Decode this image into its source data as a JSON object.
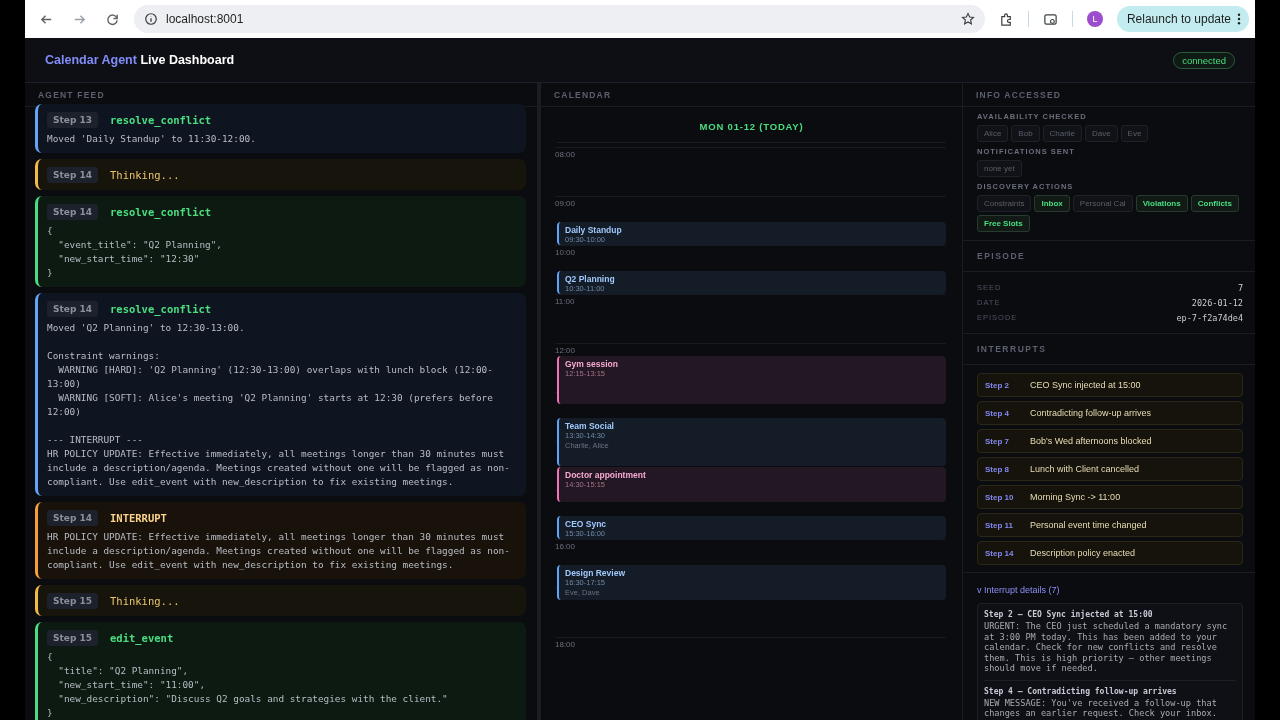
{
  "browser": {
    "url": "localhost:8001",
    "avatar": "L",
    "relaunch": "Relaunch to update"
  },
  "header": {
    "title_accent": "Calendar Agent",
    "title_rest": "Live Dashboard",
    "status": "connected"
  },
  "feed": {
    "title": "AGENT FEED",
    "entries": [
      {
        "kind": "result",
        "step": "Step 13",
        "name": "resolve_conflict",
        "body": "Moved 'Daily Standup' to 11:30-12:00."
      },
      {
        "kind": "thinking",
        "step": "Step 14",
        "name": "Thinking..."
      },
      {
        "kind": "call",
        "step": "Step 14",
        "name": "resolve_conflict",
        "body": "{\n  \"event_title\": \"Q2 Planning\",\n  \"new_start_time\": \"12:30\"\n}"
      },
      {
        "kind": "result",
        "step": "Step 14",
        "name": "resolve_conflict",
        "body": "Moved 'Q2 Planning' to 12:30-13:00.\n\nConstraint warnings:\n  WARNING [HARD]: 'Q2 Planning' (12:30-13:00) overlaps with lunch block (12:00-13:00)\n  WARNING [SOFT]: Alice's meeting 'Q2 Planning' starts at 12:30 (prefers before 12:00)\n\n--- INTERRUPT ---\nHR POLICY UPDATE: Effective immediately, all meetings longer than 30 minutes must include a description/agenda. Meetings created without one will be flagged as non-compliant. Use edit_event with new_description to fix existing meetings."
      },
      {
        "kind": "interrupt",
        "step": "Step 14",
        "name": "INTERRUPT",
        "body": "HR POLICY UPDATE: Effective immediately, all meetings longer than 30 minutes must include a description/agenda. Meetings created without one will be flagged as non-compliant. Use edit_event with new_description to fix existing meetings."
      },
      {
        "kind": "thinking",
        "step": "Step 15",
        "name": "Thinking..."
      },
      {
        "kind": "call",
        "step": "Step 15",
        "name": "edit_event",
        "body": "{\n  \"title\": \"Q2 Planning\",\n  \"new_start_time\": \"11:00\",\n  \"new_description\": \"Discuss Q2 goals and strategies with the client.\"\n}"
      }
    ]
  },
  "calendar": {
    "title": "CALENDAR",
    "day": "MON 01-12 (TODAY)",
    "hours": [
      "08:00",
      "09:00",
      "10:00",
      "11:00",
      "12:00",
      "16:00",
      "18:00"
    ],
    "events": [
      {
        "title": "Daily Standup",
        "time": "09:30-10:00",
        "color": "#60a5fa"
      },
      {
        "title": "Q2 Planning",
        "time": "10:30-11:00",
        "color": "#60a5fa"
      },
      {
        "title": "Gym session",
        "time": "12:15-13:15",
        "color": "#f472b6"
      },
      {
        "title": "Team Social",
        "time": "13:30-14:30",
        "people": "Charlie, Alice",
        "color": "#60a5fa"
      },
      {
        "title": "Doctor appointment",
        "time": "14:30-15:15",
        "color": "#f472b6"
      },
      {
        "title": "CEO Sync",
        "time": "15:30-16:00",
        "color": "#60a5fa"
      },
      {
        "title": "Design Review",
        "time": "16:30-17:15",
        "people": "Eve, Dave",
        "color": "#60a5fa"
      }
    ]
  },
  "info": {
    "title": "INFO ACCESSED",
    "groups": [
      {
        "label": "AVAILABILITY CHECKED",
        "chips": [
          {
            "text": "Alice",
            "active": false
          },
          {
            "text": "Bob",
            "active": false
          },
          {
            "text": "Charlie",
            "active": false
          },
          {
            "text": "Dave",
            "active": false
          },
          {
            "text": "Eve",
            "active": false
          }
        ]
      },
      {
        "label": "NOTIFICATIONS SENT",
        "chips": [
          {
            "text": "none yet",
            "active": false
          }
        ]
      },
      {
        "label": "DISCOVERY ACTIONS",
        "chips": [
          {
            "text": "Constraints",
            "active": false
          },
          {
            "text": "Inbox",
            "active": true
          },
          {
            "text": "Personal Cal",
            "active": false
          },
          {
            "text": "Violations",
            "active": true
          },
          {
            "text": "Conflicts",
            "active": true
          },
          {
            "text": "Free Slots",
            "active": true
          }
        ]
      }
    ]
  },
  "episode": {
    "title": "EPISODE",
    "rows": [
      {
        "label": "SEED",
        "value": "7"
      },
      {
        "label": "DATE",
        "value": "2026-01-12"
      },
      {
        "label": "EPISODE",
        "value": "ep-7-f2a74de4"
      }
    ]
  },
  "interrupts": {
    "title": "INTERRUPTS",
    "items": [
      {
        "step": "Step 2",
        "text": "CEO Sync injected at 15:00"
      },
      {
        "step": "Step 4",
        "text": "Contradicting follow-up arrives"
      },
      {
        "step": "Step 7",
        "text": "Bob's Wed afternoons blocked"
      },
      {
        "step": "Step 8",
        "text": "Lunch with Client cancelled"
      },
      {
        "step": "Step 10",
        "text": "Morning Sync -> 11:00"
      },
      {
        "step": "Step 11",
        "text": "Personal event time changed"
      },
      {
        "step": "Step 14",
        "text": "Description policy enacted"
      }
    ],
    "details_toggle": {
      "caret": "v",
      "label": "Interrupt details (7)",
      "expanded": true
    },
    "details": [
      {
        "title": "Step 2 — CEO Sync injected at 15:00",
        "body": "URGENT: The CEO just scheduled a mandatory sync at 3:00 PM today. This has been added to your calendar. Check for new conflicts and resolve them. This is high priority — other meetings should move if needed."
      },
      {
        "title": "Step 4 — Contradicting follow-up arrives",
        "body": "NEW MESSAGE: You've received a follow-up that changes an earlier request. Check your inbox."
      }
    ]
  }
}
